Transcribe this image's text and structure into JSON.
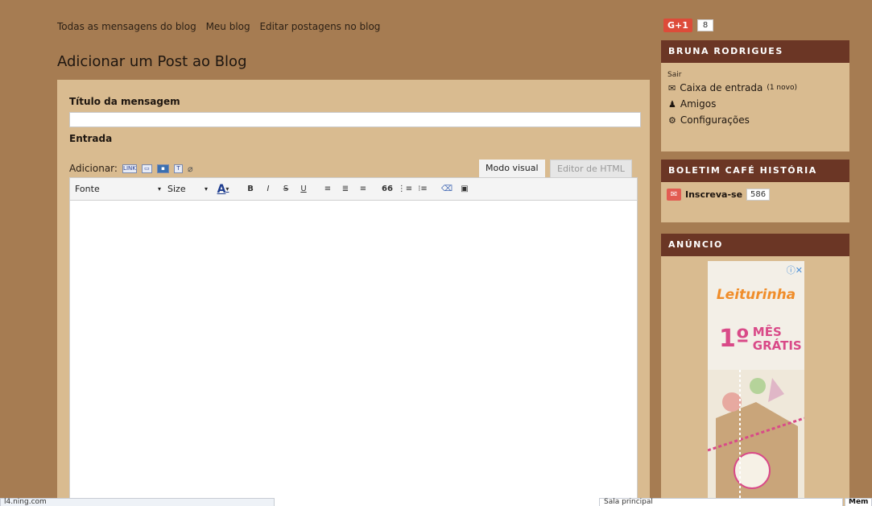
{
  "topnav": {
    "links": [
      "Todas as mensagens do blog",
      "Meu blog",
      "Editar postagens no blog"
    ]
  },
  "page": {
    "title": "Adicionar um Post ao Blog"
  },
  "form": {
    "title_label": "Título da mensagem",
    "title_value": "",
    "entry_label": "Entrada",
    "add_label": "Adicionar:",
    "add_icons": [
      "link-icon",
      "image-icon",
      "video-icon",
      "text-icon",
      "attach-icon"
    ],
    "add_link_text": "LINK",
    "add_text_icon": "T",
    "tabs": {
      "visual": "Modo visual",
      "html": "Editor de HTML"
    },
    "toolbar": {
      "font_select": "Fonte",
      "size_select": "Size",
      "font_color": "A",
      "bold": "B",
      "italic": "I",
      "strike": "S",
      "underline": "U",
      "quote": "66"
    }
  },
  "social": {
    "gplus_label": "G+1",
    "gplus_count": "8"
  },
  "sidebar": {
    "user": {
      "name": "BRUNA RODRIGUES",
      "logout": "Sair",
      "inbox_label": "Caixa de entrada",
      "inbox_new": "(1 novo)",
      "friends_label": "Amigos",
      "settings_label": "Configurações"
    },
    "newsletter": {
      "title": "BOLETIM CAFÉ HISTÓRIA",
      "subscribe_label": "Inscreva-se",
      "subscribe_count": "586"
    },
    "ad": {
      "title": "ANÚNCIO",
      "brand": "Leiturinha",
      "promo_number": "1º",
      "promo_line1": "MÊS",
      "promo_line2": "GRÁTIS"
    }
  },
  "statusbar": {
    "left": "l4.ning.com",
    "right": "Sala principal",
    "far": "Mem"
  },
  "colors": {
    "page_bg": "#a67c52",
    "panel_bg": "#d9bb90",
    "widget_header": "#6b3625",
    "gplus_red": "#dd4b39",
    "ad_orange": "#f08d2a",
    "ad_pink": "#d94a88"
  }
}
